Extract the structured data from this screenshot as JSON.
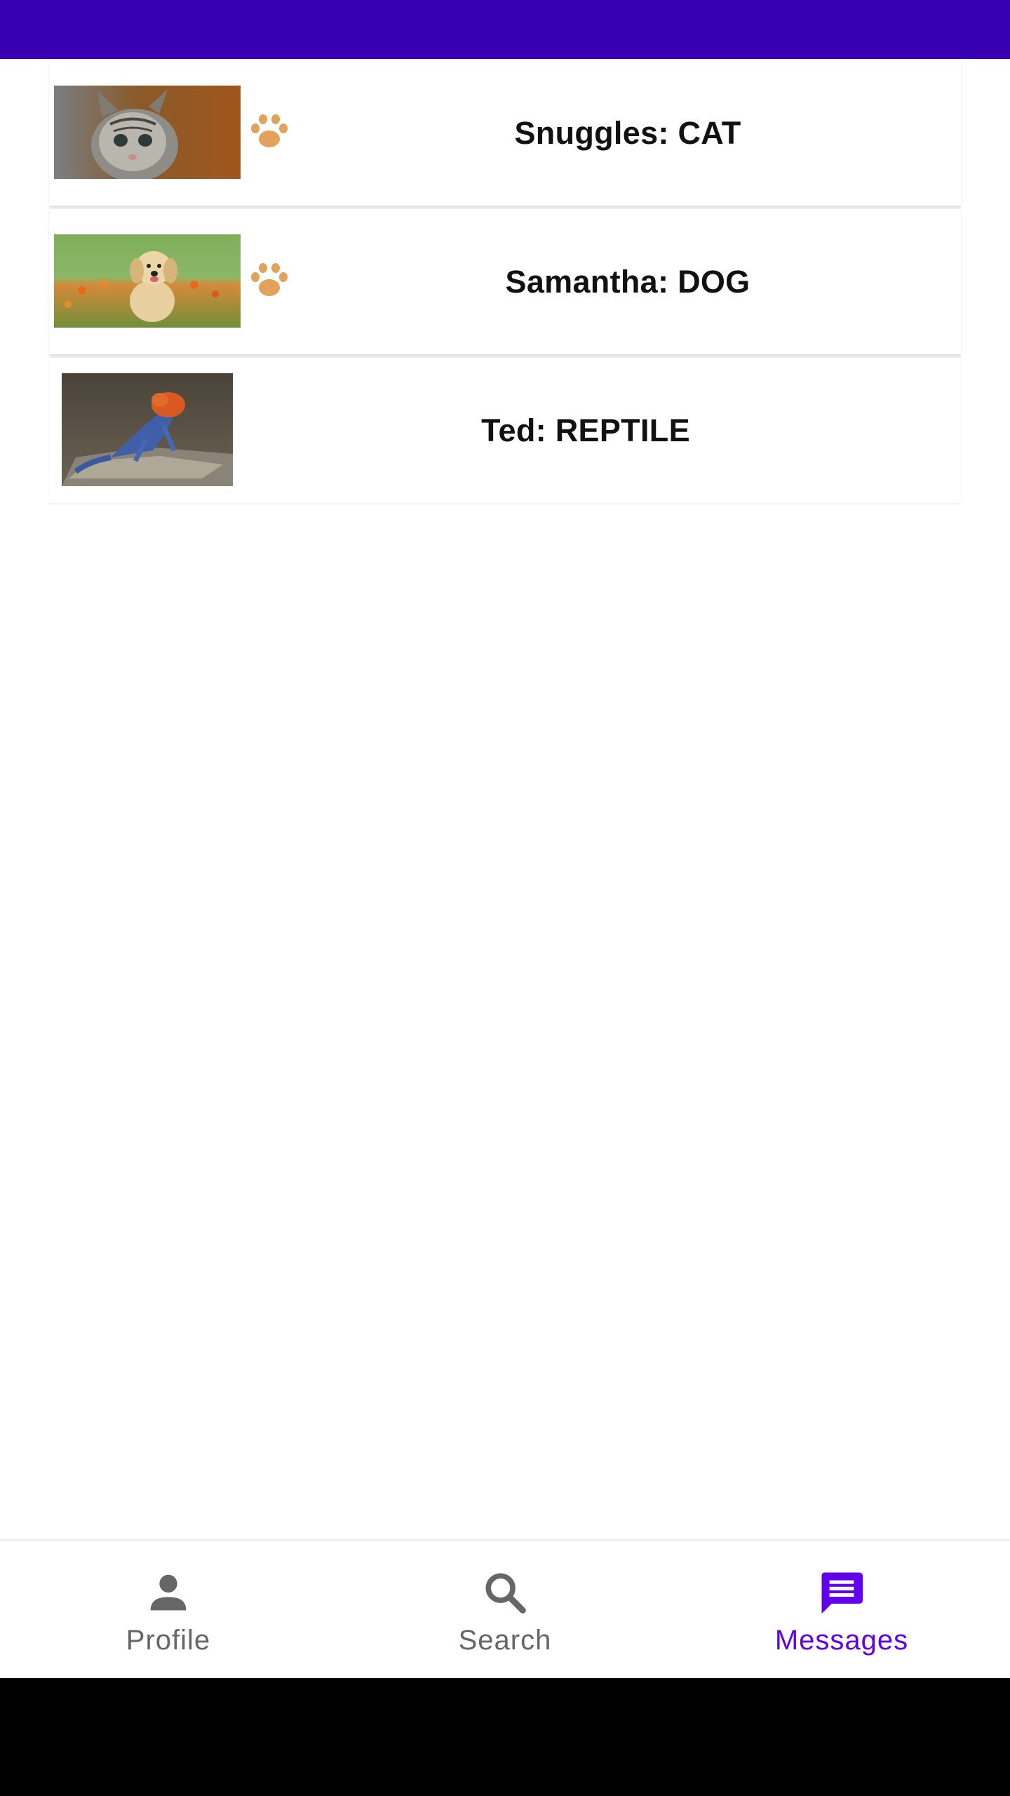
{
  "pets": [
    {
      "name_label": "Snuggles: CAT",
      "photo_icon": "cat-photo",
      "has_paw": true
    },
    {
      "name_label": "Samantha: DOG",
      "photo_icon": "dog-photo",
      "has_paw": true
    },
    {
      "name_label": "Ted: REPTILE",
      "photo_icon": "lizard-photo",
      "has_paw": false
    }
  ],
  "bottom_nav": {
    "items": [
      {
        "label": "Profile",
        "icon": "person-icon",
        "active": false
      },
      {
        "label": "Search",
        "icon": "search-icon",
        "active": false
      },
      {
        "label": "Messages",
        "icon": "message-icon",
        "active": true
      }
    ]
  },
  "colors": {
    "status_bar": "#3700b3",
    "active_nav": "#6200ee",
    "inactive_nav": "#666666",
    "paw": "#e2a259"
  }
}
